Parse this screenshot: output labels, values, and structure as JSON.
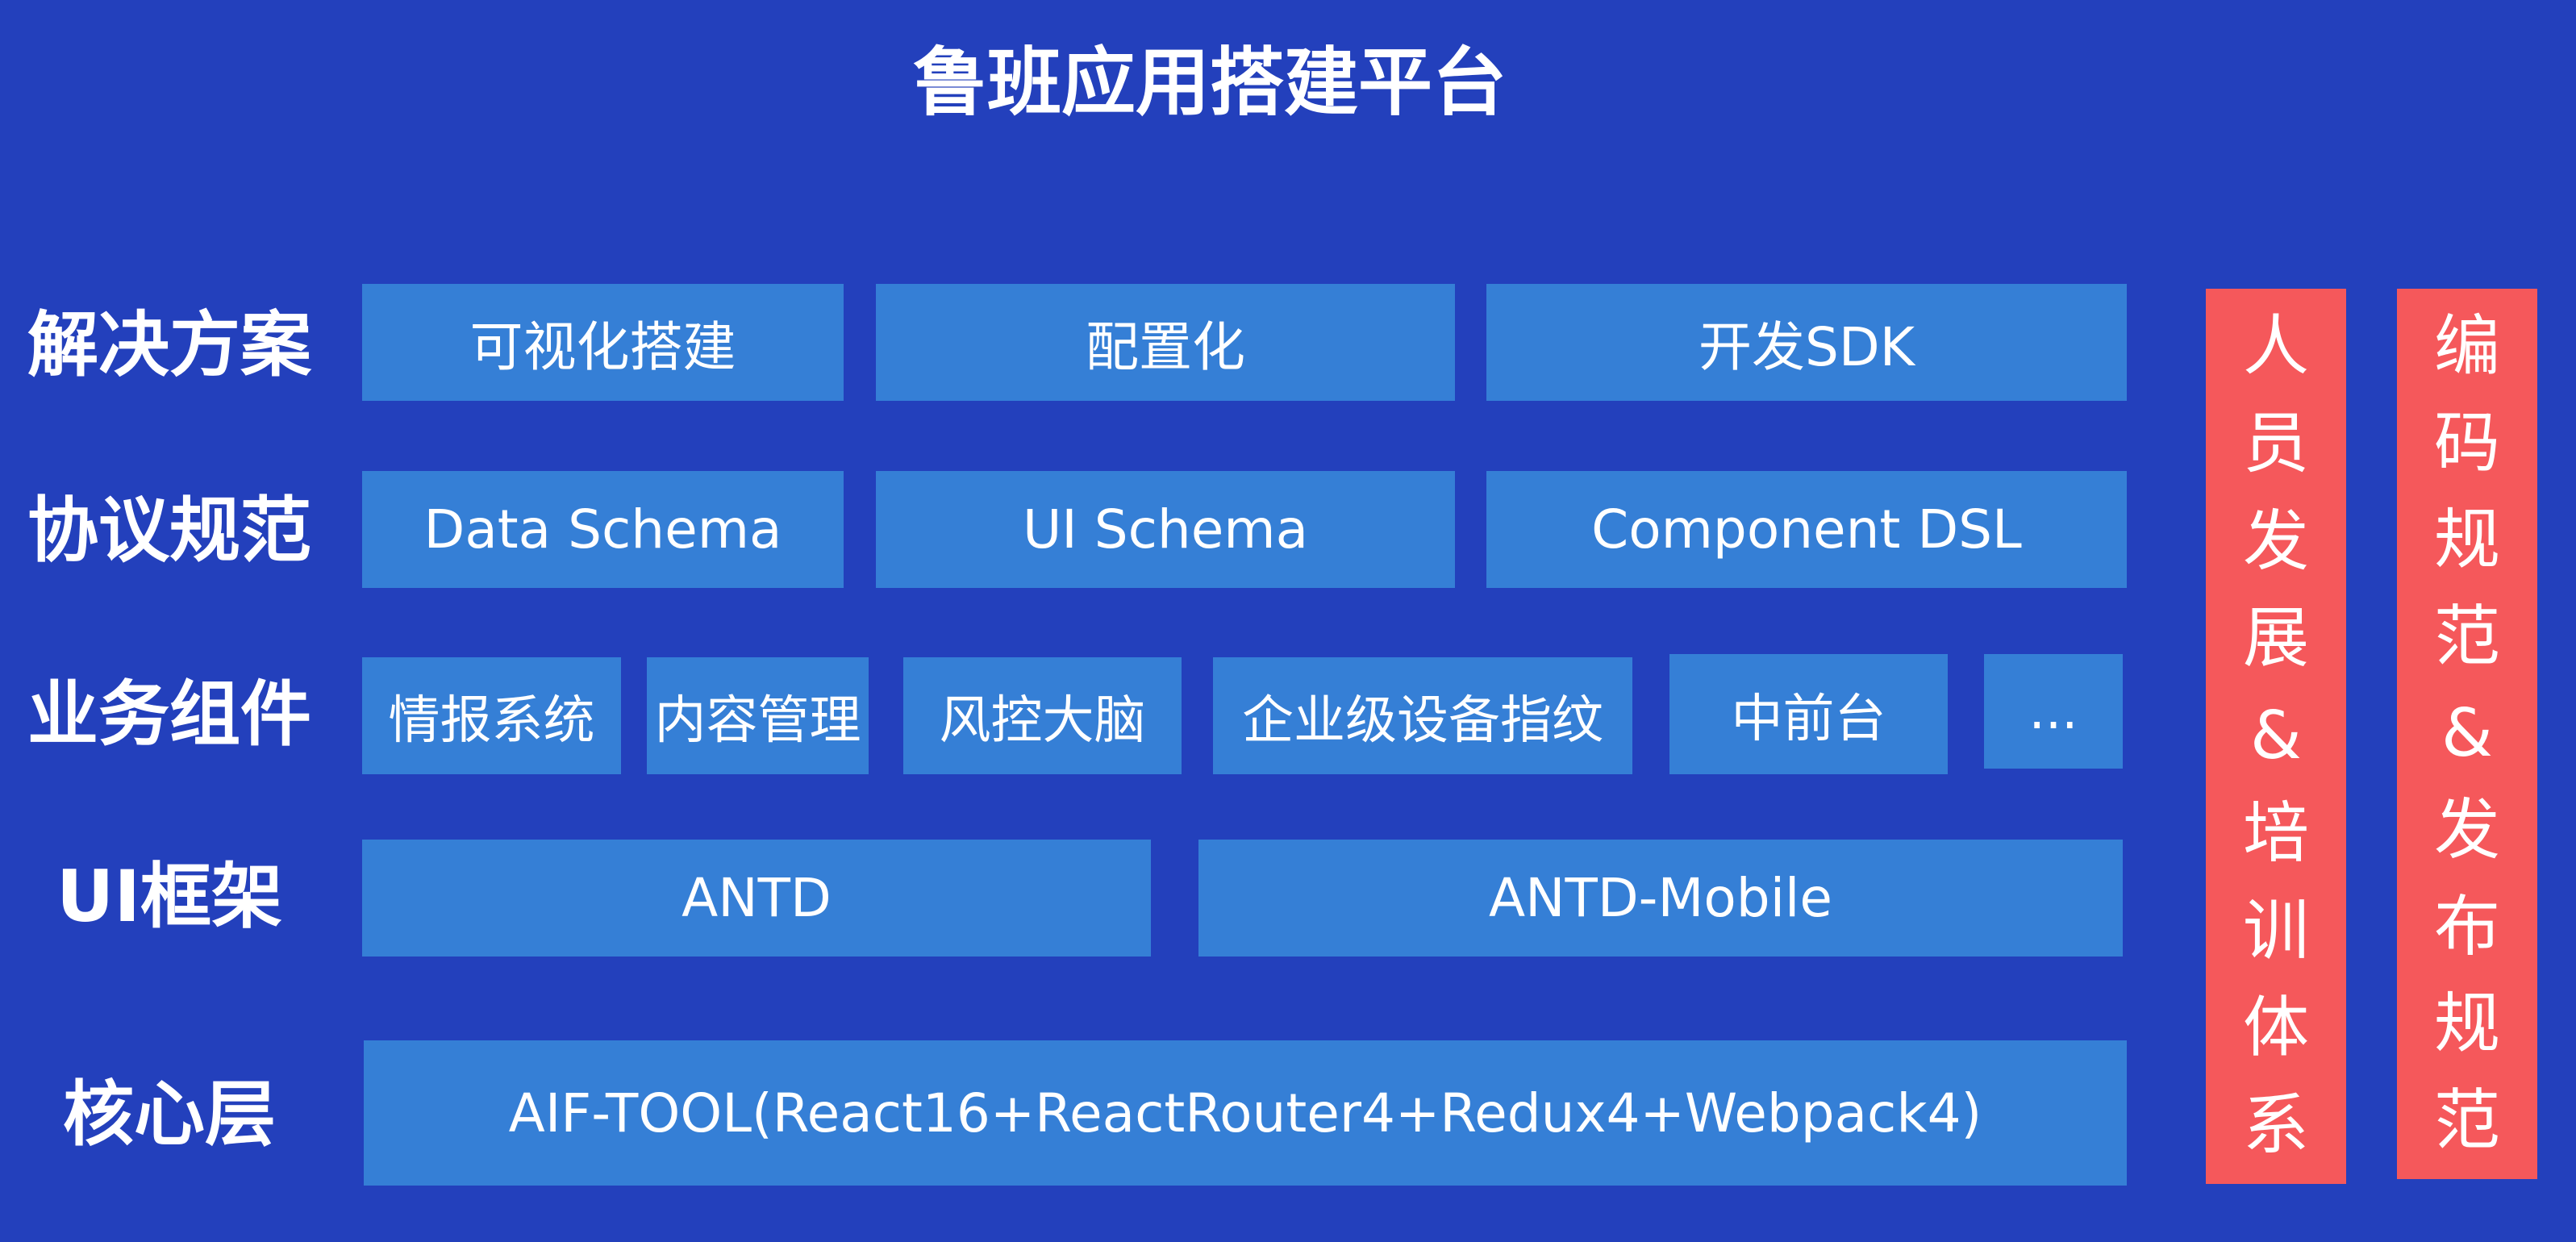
{
  "title": "鲁班应用搭建平台",
  "colors": {
    "background": "#2340bc",
    "box": "#357fd6",
    "side_column": "#f5585b",
    "text": "#ffffff"
  },
  "rows": [
    {
      "label": "解决方案",
      "items": [
        "可视化搭建",
        "配置化",
        "开发SDK"
      ]
    },
    {
      "label": "协议规范",
      "items": [
        "Data Schema",
        "UI Schema",
        "Component DSL"
      ]
    },
    {
      "label": "业务组件",
      "items": [
        "情报系统",
        "内容管理",
        "风控大脑",
        "企业级设备指纹",
        "中前台",
        "..."
      ]
    },
    {
      "label": "UI框架",
      "items": [
        "ANTD",
        "ANTD-Mobile"
      ]
    },
    {
      "label": "核心层",
      "items": [
        "AIF-TOOL(React16+ReactRouter4+Redux4+Webpack4)"
      ]
    }
  ],
  "side_columns": [
    {
      "label": "人员发展&培训体系",
      "chars": [
        "人",
        "员",
        "发",
        "展",
        "&",
        "培",
        "训",
        "体",
        "系"
      ]
    },
    {
      "label": "编码规范&发布规范",
      "chars": [
        "编",
        "码",
        "规",
        "范",
        "&",
        "发",
        "布",
        "规",
        "范"
      ]
    }
  ]
}
